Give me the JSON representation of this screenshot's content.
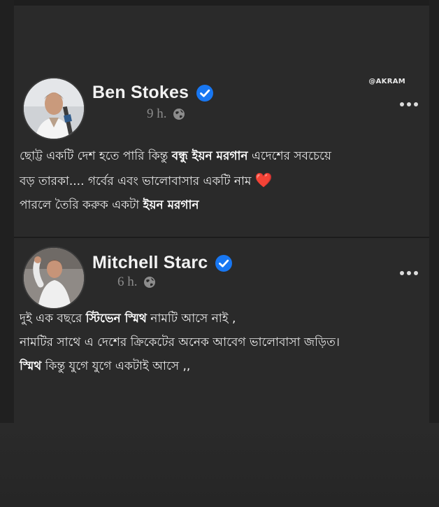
{
  "posts": [
    {
      "author": "Ben Stokes",
      "time": "9 h.",
      "watermark": "@AKRAM",
      "lines": [
        [
          "ছোট্ট একটি দেশ হতে পারি কিন্তু ",
          "বন্ধু ইয়ন মরগান",
          "  এদেশের সবচেয়ে"
        ],
        [
          "বড় তারকা.... গর্বের এবং ভালোবাসার একটি নাম ",
          "❤️"
        ],
        [
          "পারলে তৈরি করুক একটা ",
          "ইয়ন মরগান"
        ]
      ]
    },
    {
      "author": "Mitchell Starc",
      "time": "6 h.",
      "lines": [
        [
          "দুই  এক বছরে   ",
          "স্টিভেন স্মিথ",
          "     নামটি আসে নাই ,"
        ],
        [
          "নামটির সাথে এ দেশের ক্রিকেটের অনেক আবেগ ভালোবাসা জড়িত।"
        ],
        [
          "  ",
          "স্মিথ",
          " কিন্তু যুগে যুগে একটাই আসে ,,"
        ]
      ]
    }
  ],
  "icons": {
    "verified": "verified-badge-icon",
    "globe": "globe-icon",
    "more": "more-options-icon"
  },
  "colors": {
    "background": "#262626",
    "verified": "#1877f2",
    "heart": "#e3262e"
  }
}
